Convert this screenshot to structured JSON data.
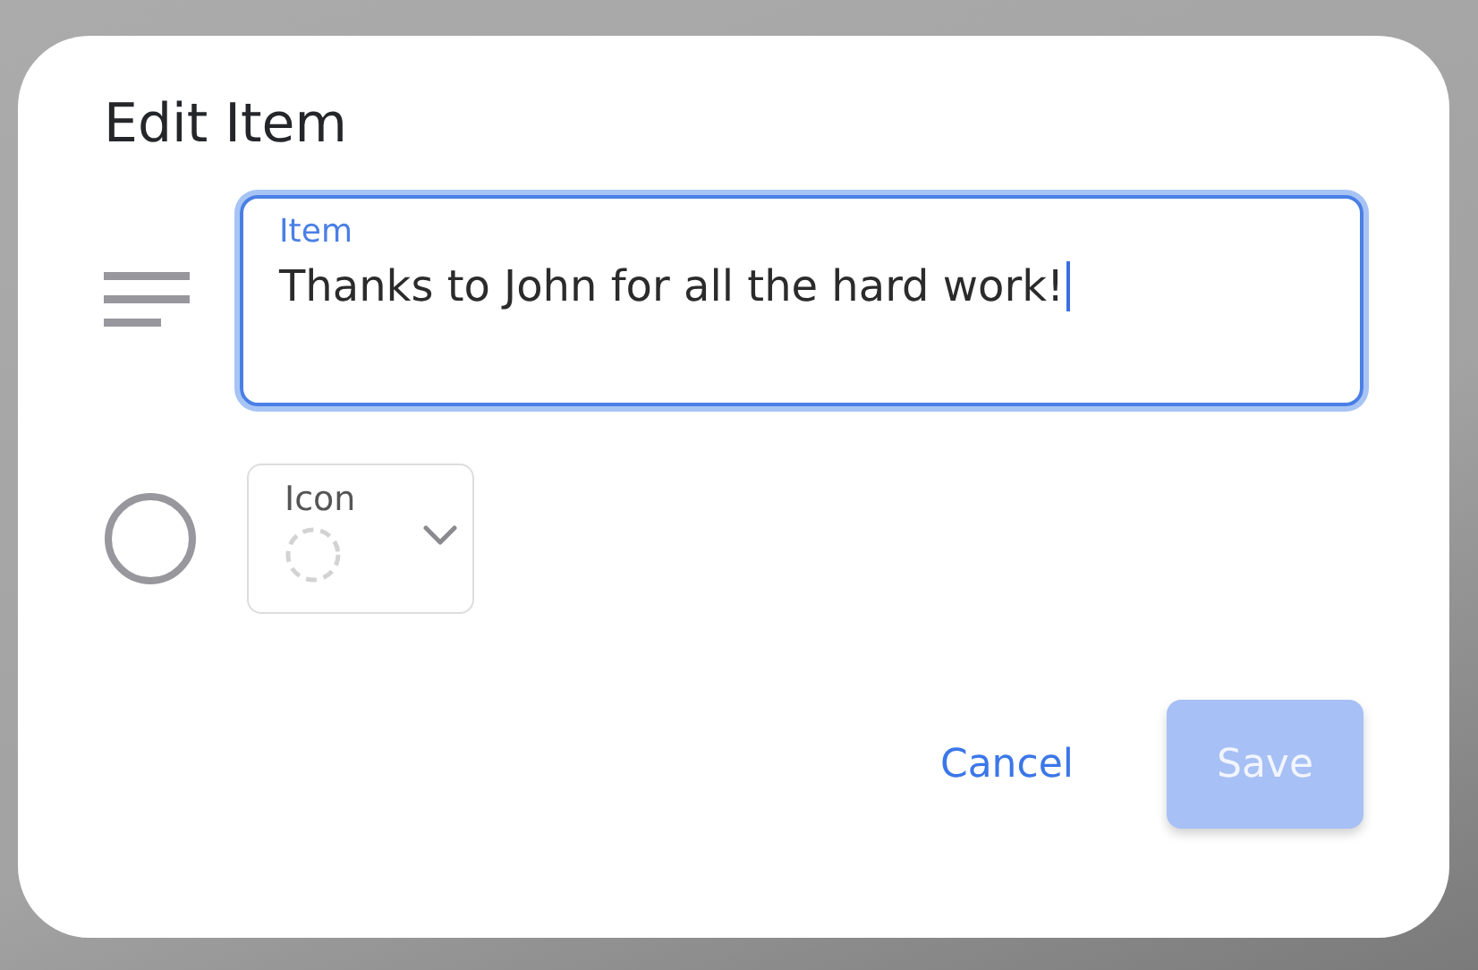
{
  "dialog": {
    "title": "Edit Item",
    "text_field": {
      "label": "Item",
      "value": "Thanks to John for all the hard work!",
      "focused": true
    },
    "icon_select": {
      "label": "Icon"
    },
    "buttons": [
      {
        "kind": "text",
        "label": "Cancel",
        "disabled": false
      },
      {
        "kind": "filled",
        "label": "Save",
        "disabled": true
      }
    ]
  }
}
